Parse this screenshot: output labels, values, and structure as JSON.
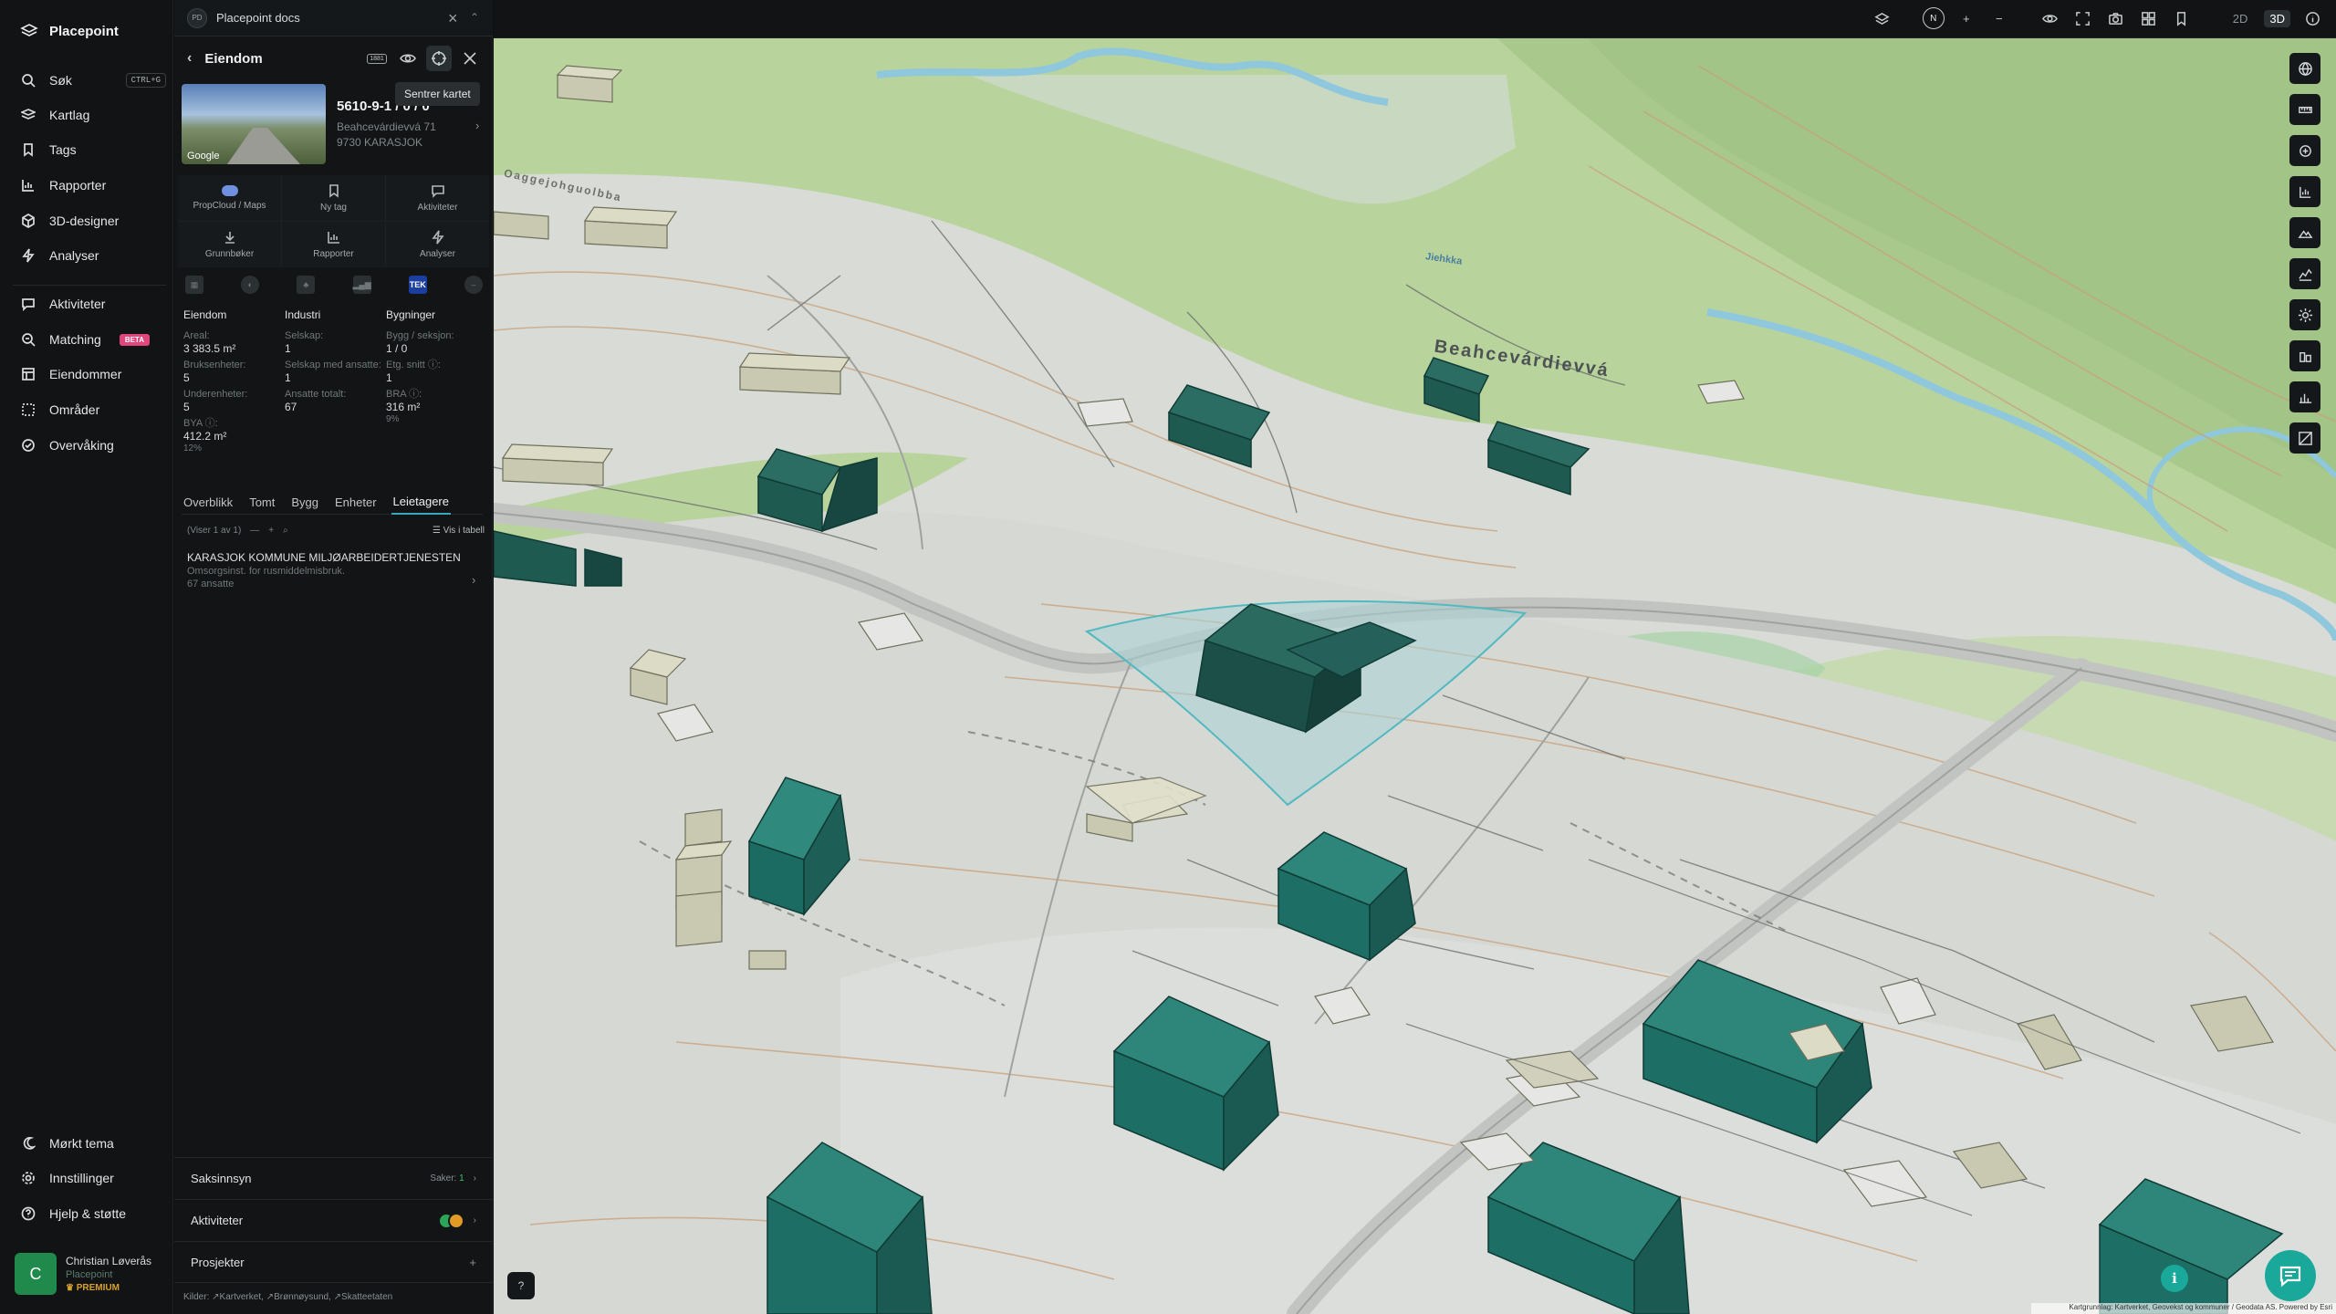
{
  "app": {
    "brand": "Placepoint",
    "doc_tab": "Placepoint docs",
    "doc_badge": "PD"
  },
  "nav": {
    "search": {
      "label": "Søk",
      "shortcut": "CTRL+G"
    },
    "items": [
      {
        "label": "Kartlag",
        "icon": "layers-icon"
      },
      {
        "label": "Tags",
        "icon": "bookmark-icon"
      },
      {
        "label": "Rapporter",
        "icon": "chart-icon"
      },
      {
        "label": "3D-designer",
        "icon": "cube-icon"
      },
      {
        "label": "Analyser",
        "icon": "bolt-icon"
      },
      {
        "label": "Aktiviteter",
        "icon": "chat-icon"
      },
      {
        "label": "Matching",
        "icon": "match-icon",
        "badge": "BETA"
      },
      {
        "label": "Eiendommer",
        "icon": "building-icon"
      },
      {
        "label": "Områder",
        "icon": "area-icon"
      },
      {
        "label": "Overvåking",
        "icon": "watch-icon"
      }
    ],
    "bottom": [
      {
        "label": "Mørkt tema",
        "icon": "moon-icon"
      },
      {
        "label": "Innstillinger",
        "icon": "gear-icon"
      },
      {
        "label": "Hjelp & støtte",
        "icon": "help-icon"
      }
    ],
    "user": {
      "initial": "C",
      "name": "Christian Løverås",
      "org": "Placepoint",
      "tier": "PREMIUM"
    }
  },
  "panel": {
    "title": "Eiendom",
    "badge_1881": "1881",
    "tooltip": "Sentrer kartet",
    "photo_credit": "Google",
    "property_id": "5610-9-1 / 0 / 0",
    "address_line1": "Beahcevárdievvá 71",
    "address_line2": "9730 KARASJOK",
    "actions": [
      {
        "label": "PropCloud / Maps",
        "icon": "cloud-icon"
      },
      {
        "label": "Ny tag",
        "icon": "bookmark-icon"
      },
      {
        "label": "Aktiviteter",
        "icon": "chat-icon"
      },
      {
        "label": "Grunnbøker",
        "icon": "download-icon"
      },
      {
        "label": "Rapporter",
        "icon": "chart-icon"
      },
      {
        "label": "Analyser",
        "icon": "bolt-icon"
      }
    ],
    "tek_label": "TEK",
    "stats": {
      "eiendom": {
        "heading": "Eiendom",
        "areal_label": "Areal:",
        "areal": "3 383.5 m²",
        "bruks_label": "Bruksenheter:",
        "bruks": "5",
        "under_label": "Underenheter:",
        "under": "5",
        "bya_label": "BYA ⓘ:",
        "bya": "412.2 m²",
        "bya_pct": "12%"
      },
      "industri": {
        "heading": "Industri",
        "selskap_label": "Selskap:",
        "selskap": "1",
        "selskap_ans_label": "Selskap med ansatte:",
        "selskap_ans": "1",
        "ansatte_label": "Ansatte totalt:",
        "ansatte": "67"
      },
      "bygninger": {
        "heading": "Bygninger",
        "bygg_label": "Bygg / seksjon:",
        "bygg": "1 / 0",
        "etg_label": "Etg. snitt ⓘ:",
        "etg": "1",
        "bra_label": "BRA ⓘ:",
        "bra": "316 m²",
        "bra_pct": "9%"
      }
    },
    "tabs": [
      "Overblikk",
      "Tomt",
      "Bygg",
      "Enheter",
      "Leietagere"
    ],
    "active_tab": "Leietagere",
    "list_count": "(Viser 1 av 1)",
    "table_toggle": "Vis i tabell",
    "tenant": {
      "name": "KARASJOK KOMMUNE MILJØARBEIDERTJENESTEN",
      "desc": "Omsorgsinst. for rusmiddelmisbruk.",
      "employees": "67 ansatte"
    },
    "sections": {
      "saksinnsyn": {
        "label": "Saksinnsyn",
        "count_label": "Saker:",
        "count": "1"
      },
      "aktiviteter": {
        "label": "Aktiviteter"
      },
      "prosjekter": {
        "label": "Prosjekter"
      }
    },
    "sources": {
      "label": "Kilder:",
      "items": [
        "Kartverket,",
        "Brønnøysund,",
        "Skatteetaten"
      ]
    }
  },
  "map": {
    "mode_2d": "2D",
    "mode_3d": "3D",
    "compass": "N",
    "road_label": "Beahcevárdievvá",
    "road_label_2": "Oaggejohguolbba",
    "river_label": "Jiehkka",
    "credits": "Kartgrunnlag: Kartverket, Geovekst og kommuner / Geodata AS. Powered by Esri",
    "accent": "#1aa89a",
    "building_color": "#1f5a50"
  }
}
